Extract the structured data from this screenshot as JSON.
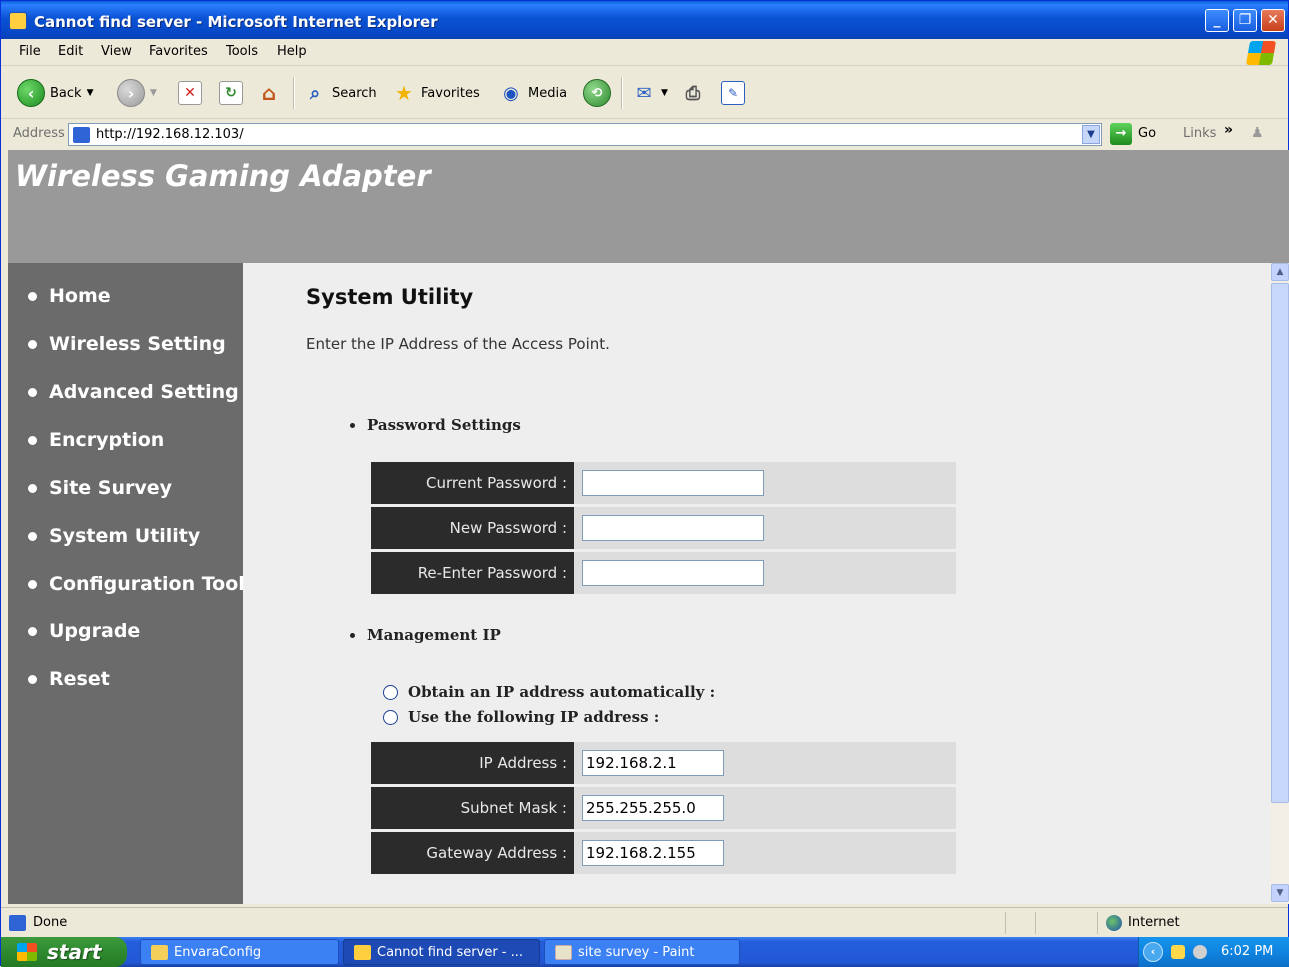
{
  "window": {
    "title": "Cannot find server - Microsoft Internet Explorer"
  },
  "menu": [
    "File",
    "Edit",
    "View",
    "Favorites",
    "Tools",
    "Help"
  ],
  "toolbar": {
    "back": "Back",
    "search": "Search",
    "favorites": "Favorites",
    "media": "Media"
  },
  "address": {
    "label": "Address",
    "url": "http://192.168.12.103/",
    "go": "Go",
    "links": "Links",
    "chevron": "»"
  },
  "page": {
    "brand": "Wireless Gaming Adapter",
    "nav": [
      "Home",
      "Wireless Setting",
      "Advanced Setting",
      "Encryption",
      "Site Survey",
      "System Utility",
      "Configuration Tool",
      "Upgrade",
      "Reset"
    ],
    "title": "System Utility",
    "description": "Enter the IP Address of the Access Point.",
    "password_section": {
      "heading": "Password Settings",
      "fields": [
        {
          "label": "Current Password :",
          "value": ""
        },
        {
          "label": "New Password :",
          "value": ""
        },
        {
          "label": "Re-Enter Password :",
          "value": ""
        }
      ]
    },
    "management_section": {
      "heading": "Management IP",
      "radio_auto": "Obtain an IP address automatically :",
      "radio_static": "Use the following IP address :",
      "fields": [
        {
          "label": "IP Address :",
          "value": "192.168.2.1"
        },
        {
          "label": "Subnet Mask :",
          "value": "255.255.255.0"
        },
        {
          "label": "Gateway Address :",
          "value": "192.168.2.155"
        }
      ]
    }
  },
  "status": {
    "text": "Done",
    "zone": "Internet"
  },
  "taskbar": {
    "start": "start",
    "tasks": [
      {
        "label": "EnvaraConfig",
        "state": "inactive"
      },
      {
        "label": "Cannot find server - ...",
        "state": "active"
      },
      {
        "label": "site survey - Paint",
        "state": "inactive"
      }
    ],
    "clock": "6:02 PM"
  }
}
